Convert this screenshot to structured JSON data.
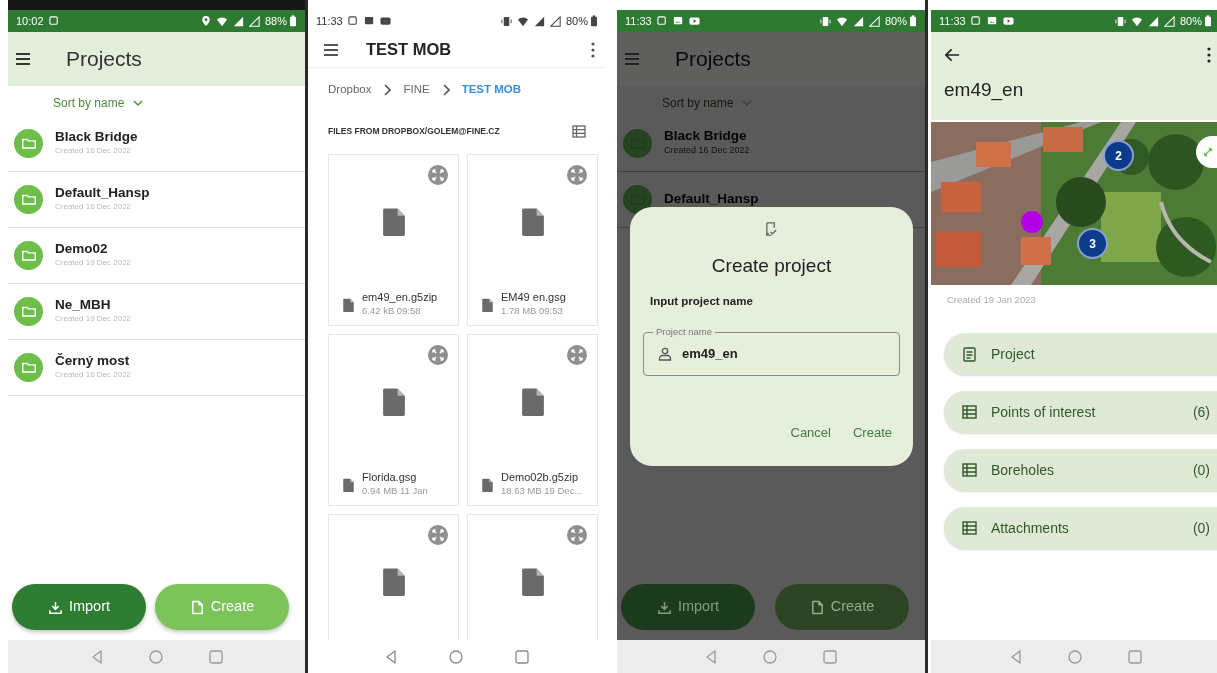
{
  "projects_screen": {
    "status": {
      "time": "10:02",
      "battery": "88%"
    },
    "title": "Projects",
    "sort": "Sort by name",
    "projects": [
      {
        "name": "Black Bridge",
        "created": "Created 16 Dec 2022"
      },
      {
        "name": "Default_Hansp",
        "created": "Created 16 Dec 2022"
      },
      {
        "name": "Demo02",
        "created": "Created 19 Dec 2022"
      },
      {
        "name": "Ne_MBH",
        "created": "Created 19 Dec 2022"
      },
      {
        "name": "Černý most",
        "created": "Created 16 Dec 2022"
      }
    ],
    "buttons": [
      {
        "label": "Import",
        "kind": "import"
      },
      {
        "label": "Create",
        "kind": "create"
      }
    ]
  },
  "files_screen": {
    "status": {
      "time": "11:33",
      "battery": "80%"
    },
    "title": "TEST MOB",
    "breadcrumb": [
      {
        "label": "Dropbox",
        "selected": false
      },
      {
        "label": "FINE",
        "selected": false
      },
      {
        "label": "TEST MOB",
        "selected": true
      }
    ],
    "section": "FILES FROM DROPBOX/GOLEM@FINE.CZ",
    "files": [
      {
        "kind": "file",
        "name": "em49_en.g5zip",
        "meta": "6.42 kB 09:58"
      },
      {
        "kind": "file",
        "name": "EM49 en.gsg",
        "meta": "1.78 MB 09:53"
      },
      {
        "kind": "file",
        "name": "Florida.gsg",
        "meta": "0.94 MB 11 Jan"
      },
      {
        "kind": "file",
        "name": "Demo02b.g5zip",
        "meta": "18.63 MB 19 Dec..."
      },
      {
        "kind": "file"
      },
      {
        "kind": "file"
      }
    ]
  },
  "dialog_screen": {
    "status": {
      "time": "11:33",
      "battery": "80%"
    },
    "background": {
      "title": "Projects",
      "sort": "Sort by name",
      "projects": [
        {
          "name": "Black Bridge",
          "created": "Created 16 Dec 2022"
        },
        {
          "name": "Default_Hansp"
        }
      ],
      "buttons": [
        {
          "label": "Import",
          "kind": "import"
        },
        {
          "label": "Create",
          "kind": "create"
        }
      ]
    },
    "dialog": {
      "title": "Create project",
      "prompt": "Input project name",
      "field": {
        "label": "Project name",
        "value": "em49_en"
      },
      "actions": [
        "Cancel",
        "Create"
      ]
    }
  },
  "detail_screen": {
    "status": {
      "time": "11:33",
      "battery": "80%"
    },
    "title": "em49_en",
    "map": {
      "kind": "picture",
      "markers": [
        {
          "label": "2",
          "color": "#0d3b8c"
        },
        {
          "label": "3",
          "color": "#0d3b8c"
        },
        {
          "kind": "dot",
          "color": "#b400e6"
        }
      ]
    },
    "created": "Created 19 Jan 2023",
    "sections": [
      {
        "label": "Project",
        "kind": "doc"
      },
      {
        "label": "Points of interest",
        "count": "(6)",
        "kind": "list"
      },
      {
        "label": "Boreholes",
        "count": "(0)",
        "kind": "list"
      },
      {
        "label": "Attachments",
        "count": "(0)",
        "kind": "list"
      }
    ]
  }
}
